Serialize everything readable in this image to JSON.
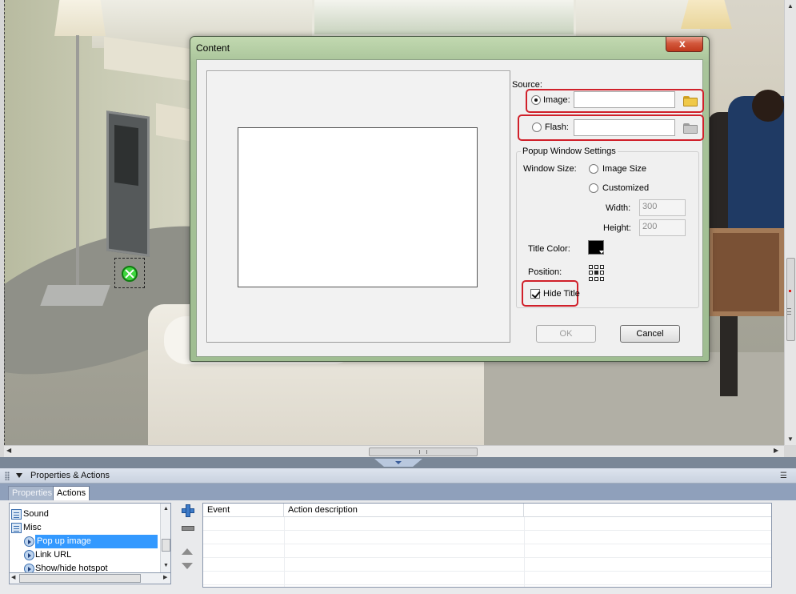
{
  "dialog": {
    "title": "Content",
    "close_label": "x",
    "source_label": "Source:",
    "image_label": "Image:",
    "image_value": "",
    "flash_label": "Flash:",
    "flash_value": "",
    "popup_group_label": "Popup Window Settings",
    "window_size_label": "Window Size:",
    "image_size_label": "Image Size",
    "customized_label": "Customized",
    "width_label": "Width:",
    "width_value": "300",
    "height_label": "Height:",
    "height_value": "200",
    "title_color_label": "Title Color:",
    "title_color": "#000000",
    "position_label": "Position:",
    "hide_title_label": "Hide Title",
    "ok_label": "OK",
    "cancel_label": "Cancel",
    "source_selected": "image",
    "hide_title_checked": true
  },
  "panel": {
    "title": "Properties & Actions",
    "tabs": [
      {
        "label": "Properties",
        "active": false
      },
      {
        "label": "Actions",
        "active": true
      }
    ],
    "tree_items": [
      {
        "label": "Sound",
        "icon": "document-icon",
        "selected": false
      },
      {
        "label": "Misc",
        "icon": "document-icon",
        "selected": false
      },
      {
        "label": "Pop up image",
        "icon": "action-icon",
        "selected": true
      },
      {
        "label": "Link URL",
        "icon": "action-icon",
        "selected": false
      },
      {
        "label": "Show/hide hotspot",
        "icon": "action-icon",
        "selected": false
      }
    ],
    "table_headers": [
      "Event",
      "Action description"
    ]
  },
  "colors": {
    "highlight": "#d0202a",
    "selection": "#3399ff",
    "hotspot": "#3ed63e"
  }
}
